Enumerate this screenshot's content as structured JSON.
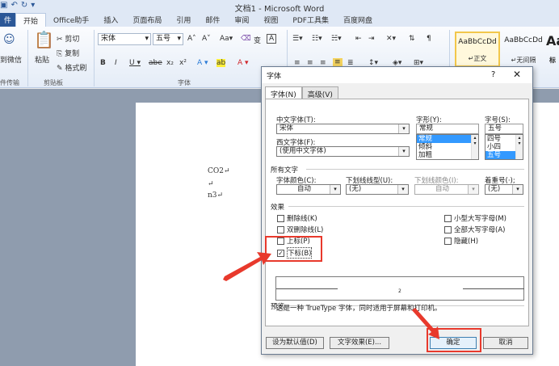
{
  "window": {
    "title": "文档1 - Microsoft Word"
  },
  "ribbon": {
    "tabs": [
      "件",
      "开始",
      "Office助手",
      "插入",
      "页面布局",
      "引用",
      "邮件",
      "审阅",
      "视图",
      "PDF工具集",
      "百度网盘"
    ],
    "active_tab": "开始",
    "left_labels": {
      "wechat": "到微信",
      "transfer": "件传输",
      "paste": "粘贴",
      "clipboard": "剪贴板",
      "cut": "剪切",
      "copy": "复制",
      "format_painter": "格式刷"
    },
    "font_name": "宋体",
    "font_size": "五号",
    "font_group": "字体",
    "styles": [
      {
        "sample": "AaBbCcDd",
        "name": "正文",
        "selected": true
      },
      {
        "sample": "AaBbCcDd",
        "name": "无间隔",
        "selected": false
      },
      {
        "sample": "Aa",
        "name": "标",
        "selected": false
      }
    ]
  },
  "document": {
    "lines": [
      "CO2",
      "n3"
    ]
  },
  "dialog": {
    "title": "字体",
    "help": "?",
    "close": "✕",
    "tabs": [
      "字体(N)",
      "高级(V)"
    ],
    "chinese_font_label": "中文字体(T):",
    "chinese_font_value": "宋体",
    "western_font_label": "西文字体(F):",
    "western_font_value": "(使用中文字体)",
    "style_label": "字形(Y):",
    "style_value": "常规",
    "style_options": [
      "常规",
      "倾斜",
      "加粗"
    ],
    "size_label": "字号(S):",
    "size_value": "五号",
    "size_options": [
      "四号",
      "小四",
      "五号"
    ],
    "all_text_label": "所有文字",
    "font_color_label": "字体颜色(C):",
    "font_color_value": "自动",
    "underline_label": "下划线线型(U):",
    "underline_value": "(无)",
    "underline_color_label": "下划线颜色(I):",
    "underline_color_value": "自动",
    "emphasis_label": "着重号(·);",
    "emphasis_value": "(无)",
    "effects_label": "效果",
    "effects": [
      {
        "label": "删除线(K)",
        "checked": false
      },
      {
        "label": "双删除线(L)",
        "checked": false
      },
      {
        "label": "上标(P)",
        "checked": false
      },
      {
        "label": "下标(B)",
        "checked": true
      }
    ],
    "effects_right": [
      {
        "label": "小型大写字母(M)",
        "checked": false
      },
      {
        "label": "全部大写字母(A)",
        "checked": false
      },
      {
        "label": "隐藏(H)",
        "checked": false
      }
    ],
    "preview_label": "预览",
    "preview_sample": "2",
    "preview_note": "这是一种 TrueType 字体，同时适用于屏幕和打印机。",
    "set_default_button": "设为默认值(D)",
    "text_effects_button": "文字效果(E)...",
    "ok_button": "确定",
    "cancel_button": "取消"
  },
  "colors": {
    "annotation": "#e8392c",
    "selection": "#3399ff",
    "file_tab": "#2b5797"
  }
}
